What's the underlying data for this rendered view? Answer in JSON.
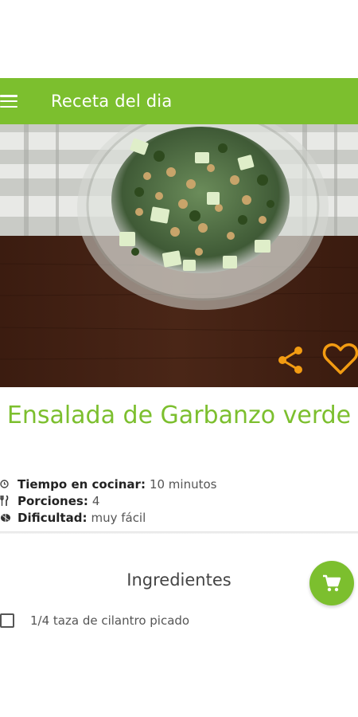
{
  "appbar": {
    "title": "Receta del dia",
    "menu_icon": "hamburger-menu-icon"
  },
  "hero": {
    "image": "chickpea-salad-bowl-photo",
    "share_icon": "share-icon",
    "favorite_icon": "heart-outline-icon",
    "action_color": "#f39c12"
  },
  "recipe": {
    "title": "Ensalada de Garbanzo verde",
    "meta": [
      {
        "icon": "clock-icon",
        "label": "Tiempo en cocinar:",
        "value": "10 minutos"
      },
      {
        "icon": "utensils-icon",
        "label": "Porciones:",
        "value": "4"
      },
      {
        "icon": "difficulty-icon",
        "label": "Dificultad:",
        "value": "muy fácil"
      }
    ]
  },
  "ingredients": {
    "header": "Ingredientes",
    "cart_icon": "shopping-cart-icon",
    "items": [
      {
        "text": "1/4 taza de cilantro picado",
        "checked": false
      }
    ]
  },
  "colors": {
    "primary": "#7cbf2e",
    "accent": "#f39c12"
  }
}
